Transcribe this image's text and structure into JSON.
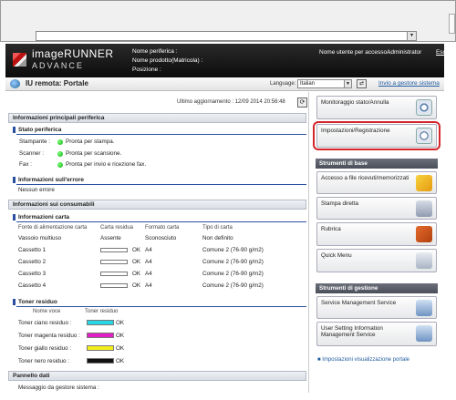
{
  "header": {
    "brand_line1": "imageRUNNER",
    "brand_line2": "ADVANCE",
    "device_name_label": "Nome periferica :",
    "product_name_label": "Nome prodotto(Matricola) :",
    "location_label": "Posizione :",
    "user_label": "Nome utente per accesso :",
    "user_value": "Administrator",
    "logout_label": "Esci"
  },
  "titlebar": {
    "title": "IU remota: Portale",
    "language_label": "Language:",
    "language_value": "Italian",
    "send_admin_label": "Invio a gestore sistema"
  },
  "main": {
    "last_update": "Ultimo aggiornamento : 12/09 2014 20:56:48",
    "device_info_header": "Informazioni principali periferica",
    "status_header": "Stato periferica",
    "status_rows": [
      {
        "label": "Stampante :",
        "value": "Pronta per stampa."
      },
      {
        "label": "Scanner :",
        "value": "Pronta per scansione."
      },
      {
        "label": "Fax :",
        "value": "Pronta per invio e ricezione fax."
      }
    ],
    "error_header": "Informazioni sull'errore",
    "error_value": "Nessun errore",
    "consumables_header": "Informazioni sui consumabili",
    "paper_header": "Informazioni carta",
    "paper_columns": [
      "Fonte di alimentazione carta",
      "Carta residua",
      "Formato carta",
      "Tipo di carta"
    ],
    "paper_rows": [
      {
        "source": "Vassoio multiuso",
        "remaining": "Assente",
        "format": "Sconosciuto",
        "type": "Non definito",
        "show_bar": false
      },
      {
        "source": "Cassetto 1",
        "remaining": "OK",
        "format": "A4",
        "type": "Comune 2 (76-90 g/m2)",
        "show_bar": true
      },
      {
        "source": "Cassetto 2",
        "remaining": "OK",
        "format": "A4",
        "type": "Comune 2 (76-90 g/m2)",
        "show_bar": true
      },
      {
        "source": "Cassetto 3",
        "remaining": "OK",
        "format": "A4",
        "type": "Comune 2 (76-90 g/m2)",
        "show_bar": true
      },
      {
        "source": "Cassetto 4",
        "remaining": "OK",
        "format": "A4",
        "type": "Comune 2 (76-90 g/m2)",
        "show_bar": true
      }
    ],
    "toner_header": "Toner residuo",
    "toner_columns": [
      "Nome voce",
      "Toner residuo"
    ],
    "toner_rows": [
      {
        "name": "Toner ciano residuo :",
        "status": "OK",
        "color": "#29d6e6"
      },
      {
        "name": "Toner magenta residuo :",
        "status": "OK",
        "color": "#e21ec6"
      },
      {
        "name": "Toner giallo residuo :",
        "status": "OK",
        "color": "#f2ef1c"
      },
      {
        "name": "Toner nero residuo :",
        "status": "OK",
        "color": "#111111"
      }
    ],
    "data_panel_header": "Pannello dati",
    "admin_message_label": "Messaggio da gestore sistema :"
  },
  "sidebar": {
    "monitor_button": "Monitoraggio stato/Annulla",
    "settings_button": "Impostazioni/Registrazione",
    "basic_tools_header": "Strumenti di base",
    "basic_tools": [
      "Accesso a file ricevuti/memorizzati",
      "Stampa diretta",
      "Rubrica",
      "Quick Menu"
    ],
    "management_header": "Strumenti di gestione",
    "management_tools": [
      "Service Management Service",
      "User Setting Information Management Service"
    ],
    "portal_settings_link": "Impostazioni visualizzazione portale"
  },
  "colors": {
    "highlight": "#d3252a",
    "status_ok": "#22aa22",
    "link": "#215ca0"
  }
}
